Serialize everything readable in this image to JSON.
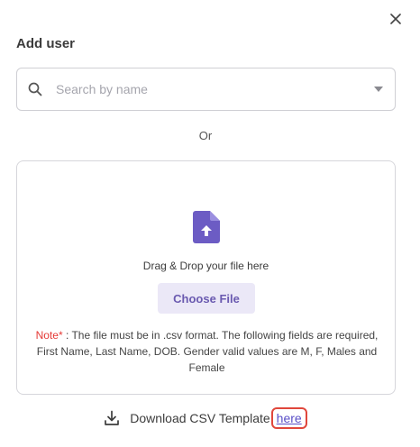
{
  "dialog": {
    "title": "Add user",
    "close_icon": "close-icon"
  },
  "search": {
    "placeholder": "Search by name",
    "value": "",
    "icon": "search-icon",
    "dropdown_icon": "caret-down-icon"
  },
  "separator": {
    "text": "Or"
  },
  "upload": {
    "icon": "file-upload-icon",
    "drag_text": "Drag & Drop your file here",
    "choose_button_label": "Choose File",
    "note_label": "Note*",
    "note_text": " : The file must be in .csv format. The following fields are required, First Name, Last Name, DOB. Gender valid values are M, F, Males and Female"
  },
  "download": {
    "icon": "download-icon",
    "text": "Download CSV Template",
    "link_label": "here"
  },
  "colors": {
    "accent": "#6a5ab0",
    "icon_purple": "#6c5cc4",
    "button_bg": "#ebe8f7",
    "note_red": "#e53935",
    "link": "#5a4fc7",
    "highlight_border": "#e0473c"
  }
}
